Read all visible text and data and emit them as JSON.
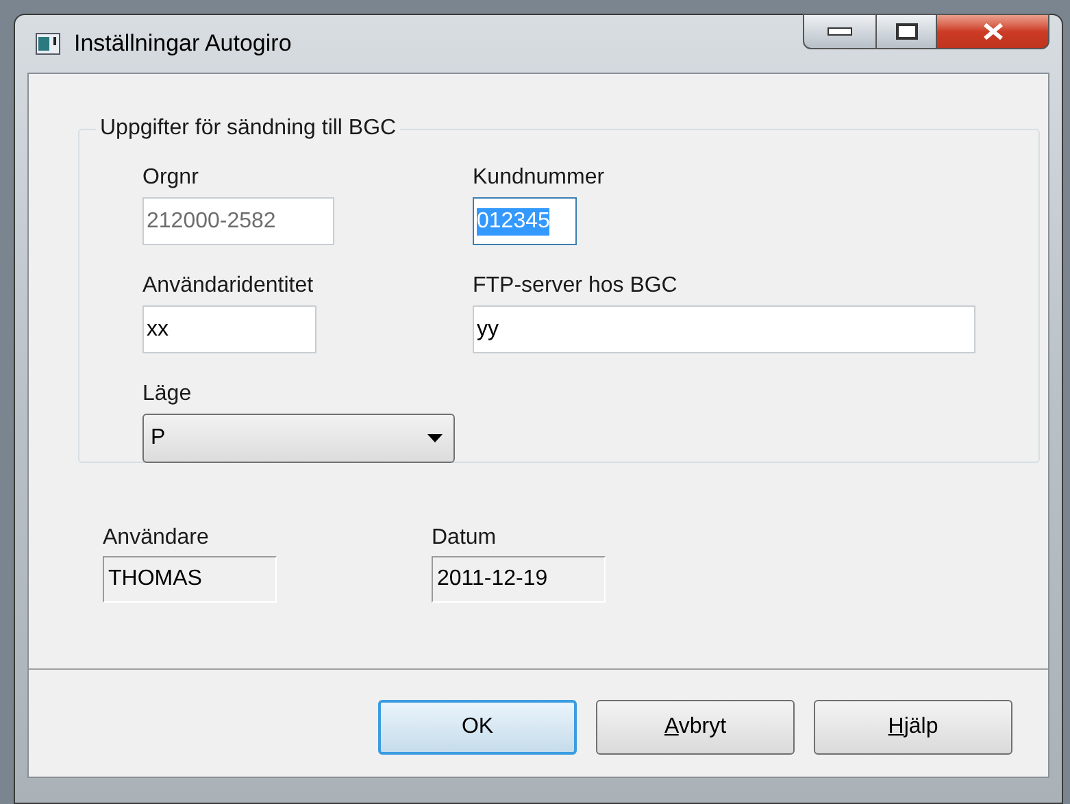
{
  "window": {
    "title": "Inställningar Autogiro"
  },
  "group": {
    "legend": "Uppgifter för sändning till BGC",
    "fields": [
      {
        "label": "Orgnr",
        "value": "212000-2582",
        "disabled": true,
        "selected": false
      },
      {
        "label": "Kundnummer",
        "value": "012345",
        "disabled": false,
        "selected": true
      },
      {
        "label": "Användaridentitet",
        "value": "xx",
        "disabled": false,
        "selected": false
      },
      {
        "label": "FTP-server hos BGC",
        "value": "yy",
        "disabled": false,
        "selected": false
      }
    ],
    "dropdown": {
      "label": "Läge",
      "value": "P"
    }
  },
  "info": [
    {
      "label": "Användare",
      "value": "THOMAS"
    },
    {
      "label": "Datum",
      "value": "2011-12-19"
    }
  ],
  "buttons": [
    {
      "label": "OK",
      "default": true,
      "first_letter_underlined": false
    },
    {
      "label": "Avbryt",
      "default": false,
      "first_letter_underlined": true
    },
    {
      "label": "Hjälp",
      "default": false,
      "first_letter_underlined": true
    }
  ]
}
